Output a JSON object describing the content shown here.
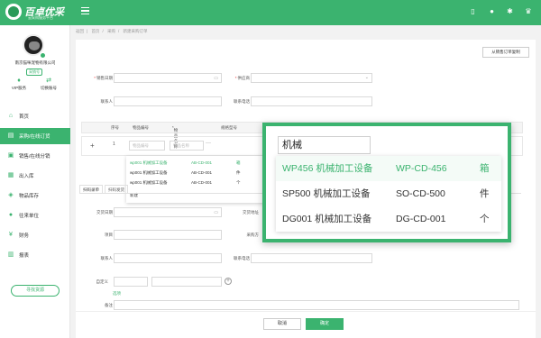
{
  "header": {
    "brand": "百卓优采",
    "brand_sub": "云采购服务平台",
    "icons": [
      "hamburger-icon",
      "mobile-icon",
      "message-icon",
      "settings-icon",
      "vip-icon"
    ]
  },
  "sidebar": {
    "company": "南京猫咪宠物有限公司",
    "role_tag": "采销号",
    "service_label": "VIP服务",
    "switch_label": "切换账号",
    "items": [
      {
        "label": "首页",
        "icon": "home-icon",
        "active": false
      },
      {
        "label": "采购/在线订货",
        "icon": "cart-icon",
        "active": true
      },
      {
        "label": "销售/在线分销",
        "icon": "sales-icon",
        "active": false
      },
      {
        "label": "出入库",
        "icon": "warehouse-icon",
        "active": false
      },
      {
        "label": "物品库存",
        "icon": "inventory-icon",
        "active": false
      },
      {
        "label": "往来单位",
        "icon": "contacts-icon",
        "active": false
      },
      {
        "label": "财务",
        "icon": "finance-icon",
        "active": false
      },
      {
        "label": "报表",
        "icon": "report-icon",
        "active": false
      }
    ],
    "find_source": "寻找货源"
  },
  "breadcrumb": [
    "返回",
    "首页",
    "采购",
    "新建采购订单"
  ],
  "copy_button": "从销售订单复制",
  "form": {
    "order_date_label": "销售日期",
    "supplier_label": "供应商",
    "contact_label": "联系人",
    "phone_label": "联系电话"
  },
  "table": {
    "headers": [
      "序号",
      "物品编号",
      "物品名称",
      "规格型号"
    ],
    "row_number": "1",
    "code_placeholder": "物品编号",
    "name_placeholder": "物品名称"
  },
  "small_dropdown": {
    "rows": [
      {
        "name": "wp001 机械加工设备",
        "code": "AB-CD-001",
        "unit": "箱"
      },
      {
        "name": "wp001 机械加工设备",
        "code": "AB-CD-001",
        "unit": "件"
      },
      {
        "name": "wp001 机械加工设备",
        "code": "AB-CD-001",
        "unit": "个"
      }
    ],
    "new_label": "新建"
  },
  "tabs": [
    "扫码录单",
    "扫码发货"
  ],
  "lower_form": {
    "delivery_date_label": "交货日期",
    "delivery_addr_label": "交货地址",
    "project_label": "项目",
    "buyer_label": "采购方",
    "contact_label": "联系人",
    "phone_label": "联系电话",
    "custom_label": "自定义",
    "remark_label": "备注",
    "attach_link": "选项"
  },
  "footer": {
    "cancel": "取消",
    "confirm": "确定"
  },
  "zoom": {
    "query": "机械",
    "rows": [
      {
        "name": "WP456 机械加工设备",
        "code": "WP-CD-456",
        "unit": "箱",
        "highlighted": true
      },
      {
        "name": "SP500 机械加工设备",
        "code": "SO-CD-500",
        "unit": "件",
        "highlighted": false
      },
      {
        "name": "DG001 机械加工设备",
        "code": "DG-CD-001",
        "unit": "个",
        "highlighted": false
      }
    ]
  },
  "colors": {
    "accent": "#3bb36f"
  }
}
